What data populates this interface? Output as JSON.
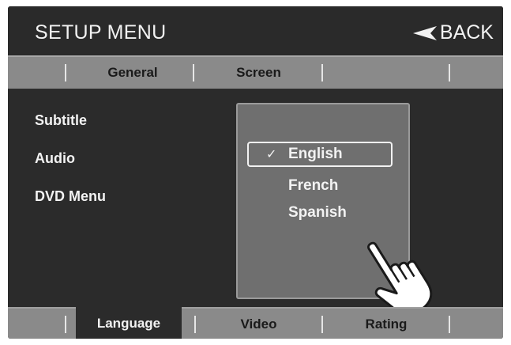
{
  "header": {
    "title": "SETUP MENU",
    "back_label": "BACK"
  },
  "top_tabs": {
    "general": "General",
    "screen": "Screen"
  },
  "menu": {
    "items": [
      "Subtitle",
      "Audio",
      "DVD Menu"
    ]
  },
  "dropdown": {
    "options": [
      "English",
      "French",
      "Spanish"
    ],
    "selected": "English",
    "check_icon": "check-icon"
  },
  "bottom_tabs": {
    "language": "Language",
    "video": "Video",
    "rating": "Rating",
    "active": "Language"
  },
  "colors": {
    "background": "#2b2b2b",
    "tab_bar": "#8a8a8a",
    "panel": "#6f6f6f",
    "text": "#f2f2f2"
  }
}
